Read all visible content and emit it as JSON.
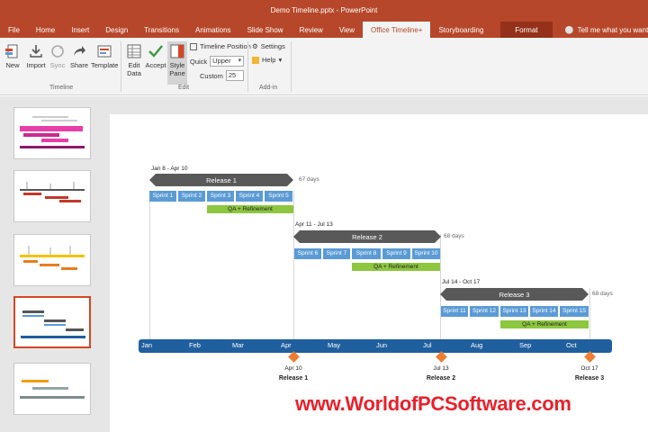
{
  "window": {
    "title": "Demo Timeline.pptx - PowerPoint"
  },
  "tabs": [
    {
      "label": "File"
    },
    {
      "label": "Home"
    },
    {
      "label": "Insert"
    },
    {
      "label": "Design"
    },
    {
      "label": "Transitions"
    },
    {
      "label": "Animations"
    },
    {
      "label": "Slide Show"
    },
    {
      "label": "Review"
    },
    {
      "label": "View"
    },
    {
      "label": "Office Timeline+"
    },
    {
      "label": "Storyboarding"
    },
    {
      "label": "Format"
    }
  ],
  "tellme": {
    "text": "Tell me what you want to do..."
  },
  "ribbon": {
    "timeline_group": {
      "new": "New",
      "import": "Import",
      "sync": "Sync",
      "share": "Share",
      "template": "Template",
      "label": "Timeline"
    },
    "edit_group": {
      "edit_data_1": "Edit",
      "edit_data_2": "Data",
      "accept": "Accept",
      "style_pane_1": "Style",
      "style_pane_2": "Pane",
      "timeline_position": "Timeline Position",
      "quick_label": "Quick",
      "quick_value": "Upper",
      "custom_label": "Custom",
      "custom_value": "25",
      "label": "Edit"
    },
    "addin_group": {
      "settings": "Settings",
      "help": "Help",
      "label": "Add-in"
    }
  },
  "slide": {
    "releases": [
      {
        "date_range": "Jan 8 - Apr 10",
        "name": "Release 1",
        "duration": "67 days",
        "sprints": [
          "Sprint 1",
          "Sprint 2",
          "Sprint 3",
          "Sprint 4",
          "Sprint 5"
        ],
        "qa": "QA + Refinement"
      },
      {
        "date_range": "Apr 11 - Jul 13",
        "name": "Release 2",
        "duration": "68 days",
        "sprints": [
          "Sprint 6",
          "Sprint 7",
          "Sprint 8",
          "Sprint 9",
          "Sprint 10"
        ],
        "qa": "QA + Refinement"
      },
      {
        "date_range": "Jul 14 - Oct 17",
        "name": "Release 3",
        "duration": "68 days",
        "sprints": [
          "Sprint 11",
          "Sprint 12",
          "Sprint 13",
          "Sprint 14",
          "Sprint 15"
        ],
        "qa": "QA + Refinement"
      }
    ],
    "months": [
      "Jan",
      "Feb",
      "Mar",
      "Apr",
      "May",
      "Jun",
      "Jul",
      "Aug",
      "Sep",
      "Oct"
    ],
    "milestones": [
      {
        "date": "Apr 10",
        "name": "Release 1"
      },
      {
        "date": "Jul 13",
        "name": "Release 2"
      },
      {
        "date": "Oct 17",
        "name": "Release 3"
      }
    ]
  },
  "colors": {
    "brand": "#b7472a",
    "sprint": "#5b9bd5",
    "qa": "#8dc63f",
    "release_bar": "#595959",
    "axis": "#1f5f9e",
    "milestone": "#ed7d31"
  },
  "watermark": "www.WorldofPCSoftware.com"
}
